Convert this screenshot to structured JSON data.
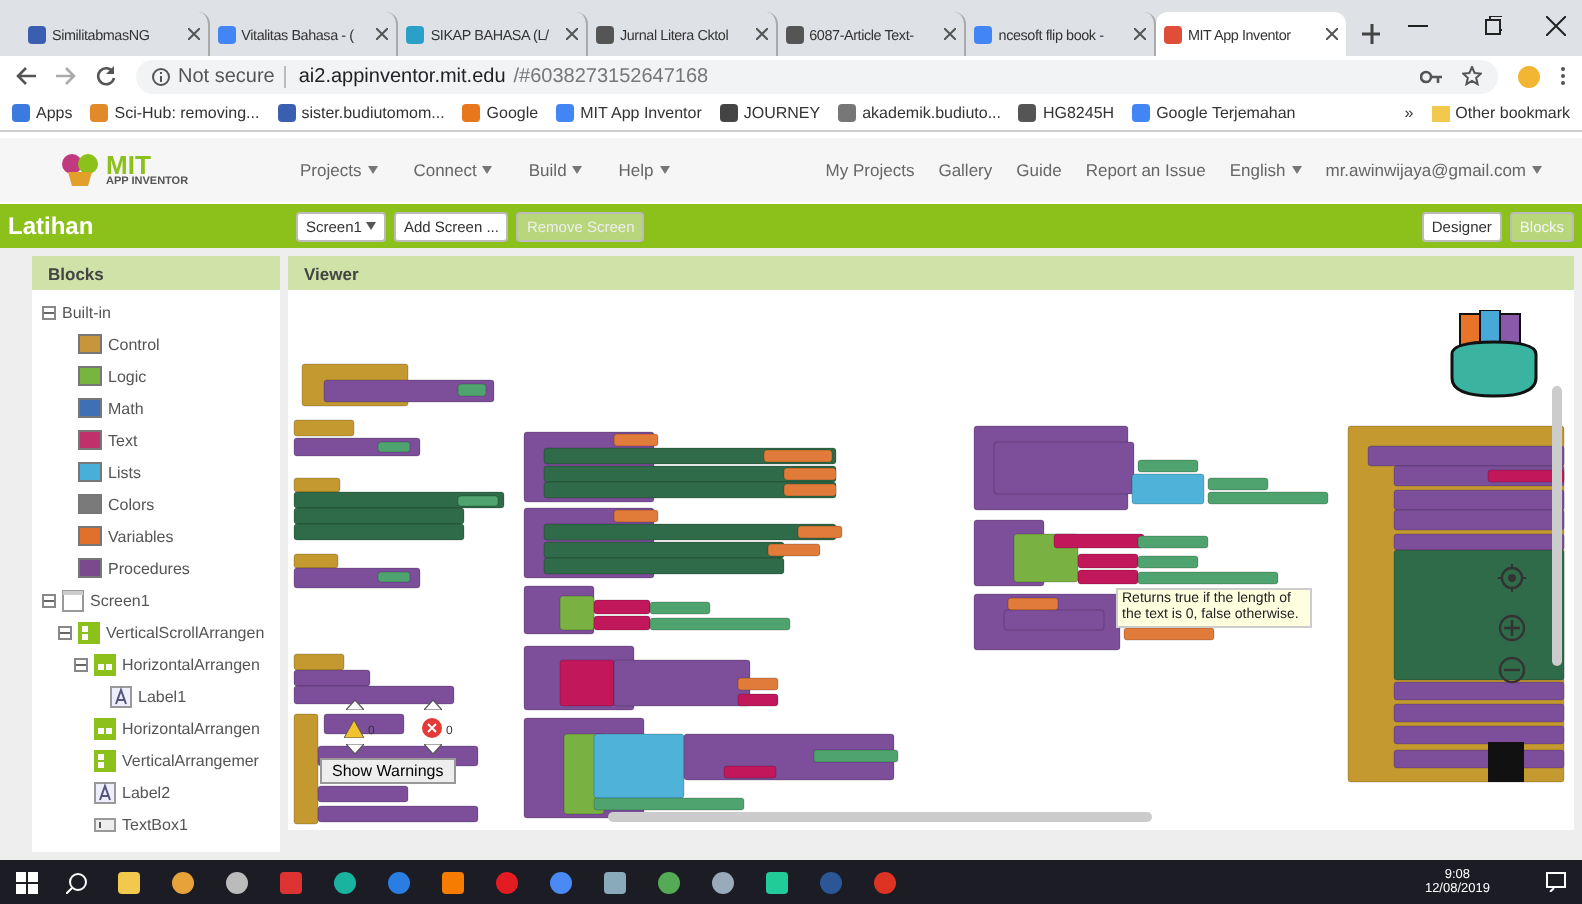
{
  "browser": {
    "tabs": [
      {
        "label": "SimilitabmasNG",
        "selected": false
      },
      {
        "label": "Vitalitas Bahasa - (",
        "selected": false
      },
      {
        "label": "SIKAP BAHASA (L/",
        "selected": false
      },
      {
        "label": "Jurnal Litera Cktol",
        "selected": false
      },
      {
        "label": "6087-Article Text-",
        "selected": false
      },
      {
        "label": "ncesoft flip book -",
        "selected": false
      },
      {
        "label": "MIT App Inventor",
        "selected": true
      }
    ],
    "address": {
      "security": "Not secure",
      "host": "ai2.appinventor.mit.edu",
      "path": "/#6038273152647168"
    },
    "bookmarks": [
      "Apps",
      "Sci-Hub: removing...",
      "sister.budiutomom...",
      "Google",
      "MIT App Inventor",
      "JOURNEY",
      "akademik.budiuto...",
      "HG8245H",
      "Google Terjemahan"
    ],
    "overflow": "»",
    "other_bookmarks": "Other bookmark"
  },
  "header": {
    "logo": {
      "title": "MIT",
      "subtitle": "APP INVENTOR"
    },
    "menus": [
      "Projects",
      "Connect",
      "Build",
      "Help"
    ],
    "links": [
      "My Projects",
      "Gallery",
      "Guide",
      "Report an Issue"
    ],
    "language": "English",
    "account": "mr.awinwijaya@gmail.com"
  },
  "project_bar": {
    "project": "Latihan",
    "screen": "Screen1",
    "add_screen": "Add Screen ...",
    "remove_screen": {
      "label": "Remove Screen",
      "disabled": true
    },
    "views": [
      {
        "label": "Designer",
        "selected": false
      },
      {
        "label": "Blocks",
        "selected": true
      }
    ]
  },
  "blocks_panel": {
    "title": "Blocks",
    "tree": [
      {
        "label": "Built-in",
        "kind": "group",
        "expanded": true,
        "children": [
          {
            "label": "Control",
            "kind": "category",
            "color": "#c8963a"
          },
          {
            "label": "Logic",
            "kind": "category",
            "color": "#77b53e"
          },
          {
            "label": "Math",
            "kind": "category",
            "color": "#3f6fb5"
          },
          {
            "label": "Text",
            "kind": "category",
            "color": "#c0306a"
          },
          {
            "label": "Lists",
            "kind": "category",
            "color": "#48b0d8"
          },
          {
            "label": "Colors",
            "kind": "category",
            "color": "#7a7a7a"
          },
          {
            "label": "Variables",
            "kind": "category",
            "color": "#e0702a"
          },
          {
            "label": "Procedures",
            "kind": "category",
            "color": "#7b4a8e"
          }
        ]
      },
      {
        "label": "Screen1",
        "kind": "screen",
        "expanded": true,
        "children": [
          {
            "label": "VerticalScrollArrangen",
            "kind": "vertical",
            "expanded": true,
            "children": [
              {
                "label": "HorizontalArrangen",
                "kind": "horizontal",
                "expanded": true,
                "children": [
                  {
                    "label": "Label1",
                    "kind": "label"
                  }
                ]
              },
              {
                "label": "HorizontalArrangen",
                "kind": "horizontal"
              },
              {
                "label": "VerticalArrangemer",
                "kind": "vertical"
              },
              {
                "label": "Label2",
                "kind": "label"
              },
              {
                "label": "TextBox1",
                "kind": "textbox"
              }
            ]
          }
        ]
      }
    ]
  },
  "viewer": {
    "title": "Viewer",
    "tooltip": "Returns true if the length of the text is 0, false otherwise.",
    "warning_count": "0",
    "error_count": "0",
    "warnings_button": "Show Warnings"
  },
  "taskbar": {
    "time": "9:08",
    "date": "12/08/2019"
  }
}
